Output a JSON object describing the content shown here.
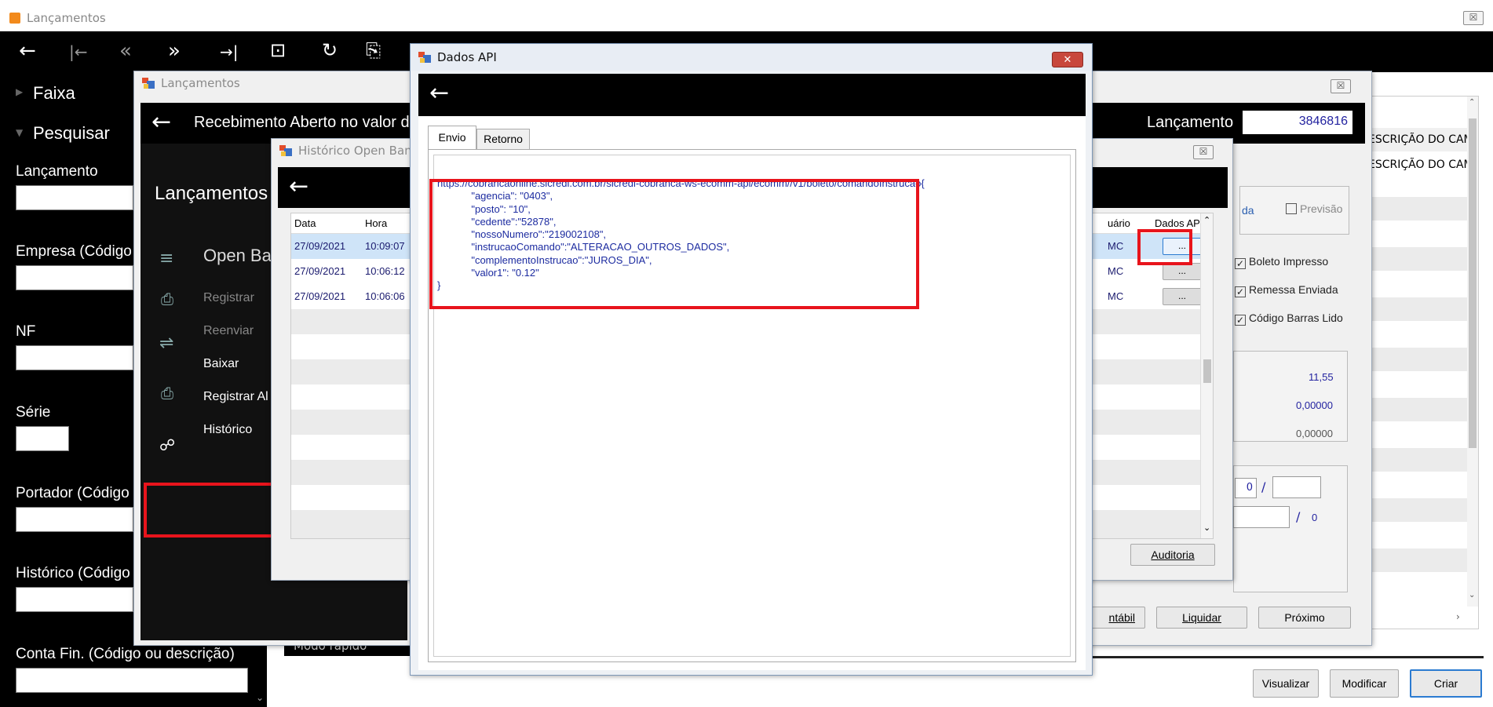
{
  "main_window": {
    "title": "Lançamentos",
    "close_label": "☒",
    "toolbar": [
      "←",
      "|←",
      "«",
      "»",
      "→|",
      "⊡",
      "↻",
      "⎘"
    ],
    "sidebar": {
      "faixa": "Faixa",
      "pesquisar": "Pesquisar",
      "fields": [
        "Lançamento",
        "Empresa (Código",
        "NF",
        "Série",
        "Portador (Código",
        "Histórico (Código",
        "Conta Fin. (Código ou descrição)"
      ]
    },
    "col_header_1": "ESCRIÇÃO DO CAM",
    "col_header_2": "ESCRIÇÃO DO CAM",
    "buttons": {
      "visualizar": "Visualizar",
      "modificar": "Modificar",
      "criar": "Criar"
    },
    "modo_rapido": "Modo rápido"
  },
  "lanc_window": {
    "title": "Lançamentos",
    "close_label": "☒",
    "header_text": "Recebimento Aberto no valor d",
    "lancamento_label": "Lançamento",
    "lancamento_value": "3846816",
    "panel_title": "Lançamentos",
    "menu": {
      "open_banking": "Open Ba",
      "registrar": "Registrar",
      "reenviar": "Reenviar",
      "baixar": "Baixar",
      "registrar_alt": "Registrar Al",
      "historico": "Histórico"
    },
    "checks": {
      "previsao": "Previsão",
      "boleto": "Boleto Impresso",
      "remessa": "Remessa Enviada",
      "codigo": "Código Barras Lido",
      "da": "da"
    },
    "values": {
      "v1": "11,55",
      "v2": "0,00000",
      "v3": "0,00000",
      "field0": "0",
      "slash1": "/",
      "slash2": "/",
      "field_last": "0"
    },
    "buttons": {
      "contabil": "ntábil",
      "liquidar": "Liquidar",
      "proximo": "Próximo"
    }
  },
  "historico_window": {
    "title": "Histórico Open Banki",
    "close_label": "☒",
    "columns": {
      "data": "Data",
      "hora": "Hora",
      "usuario": "uário",
      "dados_api": "Dados API"
    },
    "rows": [
      {
        "data": "27/09/2021",
        "hora": "10:09:07",
        "user": "MC"
      },
      {
        "data": "27/09/2021",
        "hora": "10:06:12",
        "user": "MC"
      },
      {
        "data": "27/09/2021",
        "hora": "10:06:06",
        "user": "MC"
      }
    ],
    "ellipsis": "...",
    "auditoria": "Auditoria"
  },
  "dados_api": {
    "title": "Dados API",
    "close_label": "✕",
    "tabs": {
      "envio": "Envio",
      "retorno": "Retorno"
    },
    "payload": "https://cobrancaonline.sicredi.com.br/sicredi-cobranca-ws-ecomm-api/ecomm//v1/boleto/comandoInstrucao{\n            \"agencia\": \"0403\",\n            \"posto\": \"10\",\n            \"cedente\":\"52878\",\n            \"nossoNumero\":\"219002108\",\n            \"instrucaoComando\":\"ALTERACAO_OUTROS_DADOS\",\n            \"complementoInstrucao\":\"JUROS_DIA\",\n            \"valor1\": \"0.12\"\n}"
  }
}
